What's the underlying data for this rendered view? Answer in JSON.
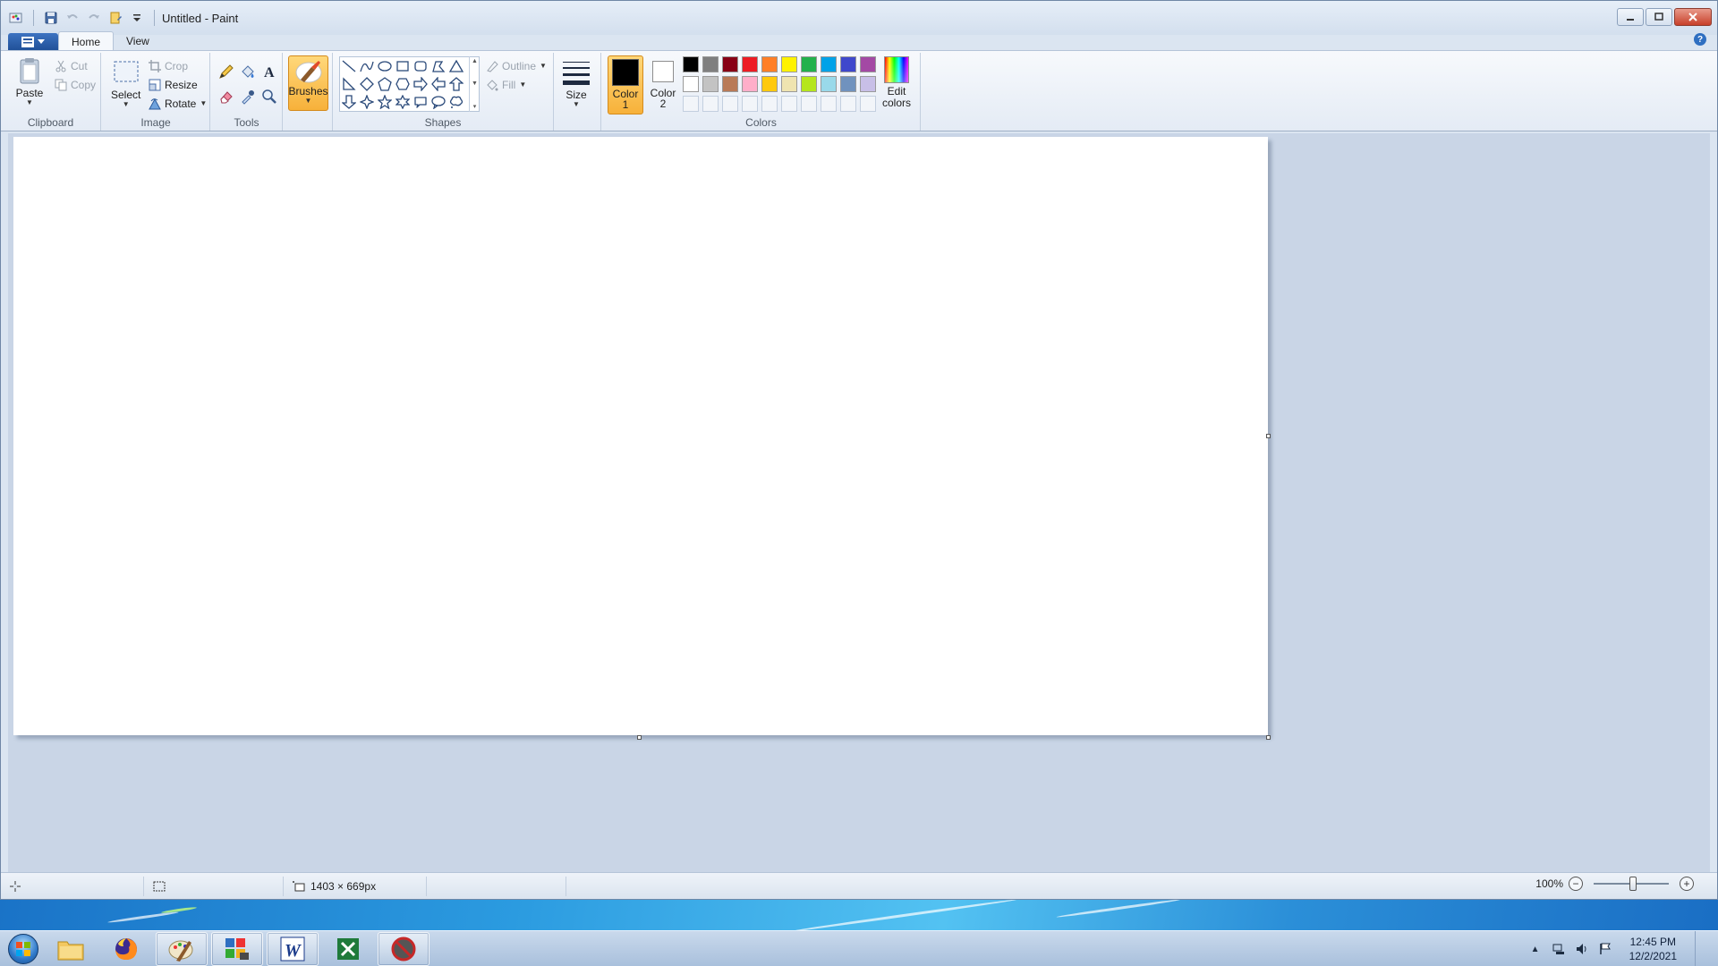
{
  "window": {
    "title": "Untitled - Paint"
  },
  "tabs": [
    {
      "label": "Home"
    },
    {
      "label": "View"
    }
  ],
  "ribbon": {
    "clipboard": {
      "group_label": "Clipboard",
      "paste": "Paste",
      "cut": "Cut",
      "copy": "Copy"
    },
    "image": {
      "group_label": "Image",
      "select": "Select",
      "crop": "Crop",
      "resize": "Resize",
      "rotate": "Rotate"
    },
    "tools": {
      "group_label": "Tools"
    },
    "brushes": "Brushes",
    "shapes": {
      "group_label": "Shapes",
      "outline": "Outline",
      "fill": "Fill"
    },
    "size": "Size",
    "colors": {
      "group_label": "Colors",
      "color1_label": "Color\n1",
      "color2_label": "Color\n2",
      "color1": "#000000",
      "color2": "#ffffff",
      "edit_colors": "Edit colors",
      "palette_row1": [
        "#000000",
        "#7f7f7f",
        "#880015",
        "#ed1c24",
        "#ff7f27",
        "#fff200",
        "#22b14c",
        "#00a2e8",
        "#3f48cc",
        "#a349a4"
      ],
      "palette_row2": [
        "#ffffff",
        "#c3c3c3",
        "#b97a57",
        "#ffaec9",
        "#ffc90e",
        "#efe4b0",
        "#b5e61d",
        "#99d9ea",
        "#7092be",
        "#c8bfe7"
      ]
    }
  },
  "status": {
    "canvas_size": "1403 × 669px",
    "zoom": "100%"
  },
  "taskbar": {
    "time": "12:45 PM",
    "date": "12/2/2021"
  }
}
